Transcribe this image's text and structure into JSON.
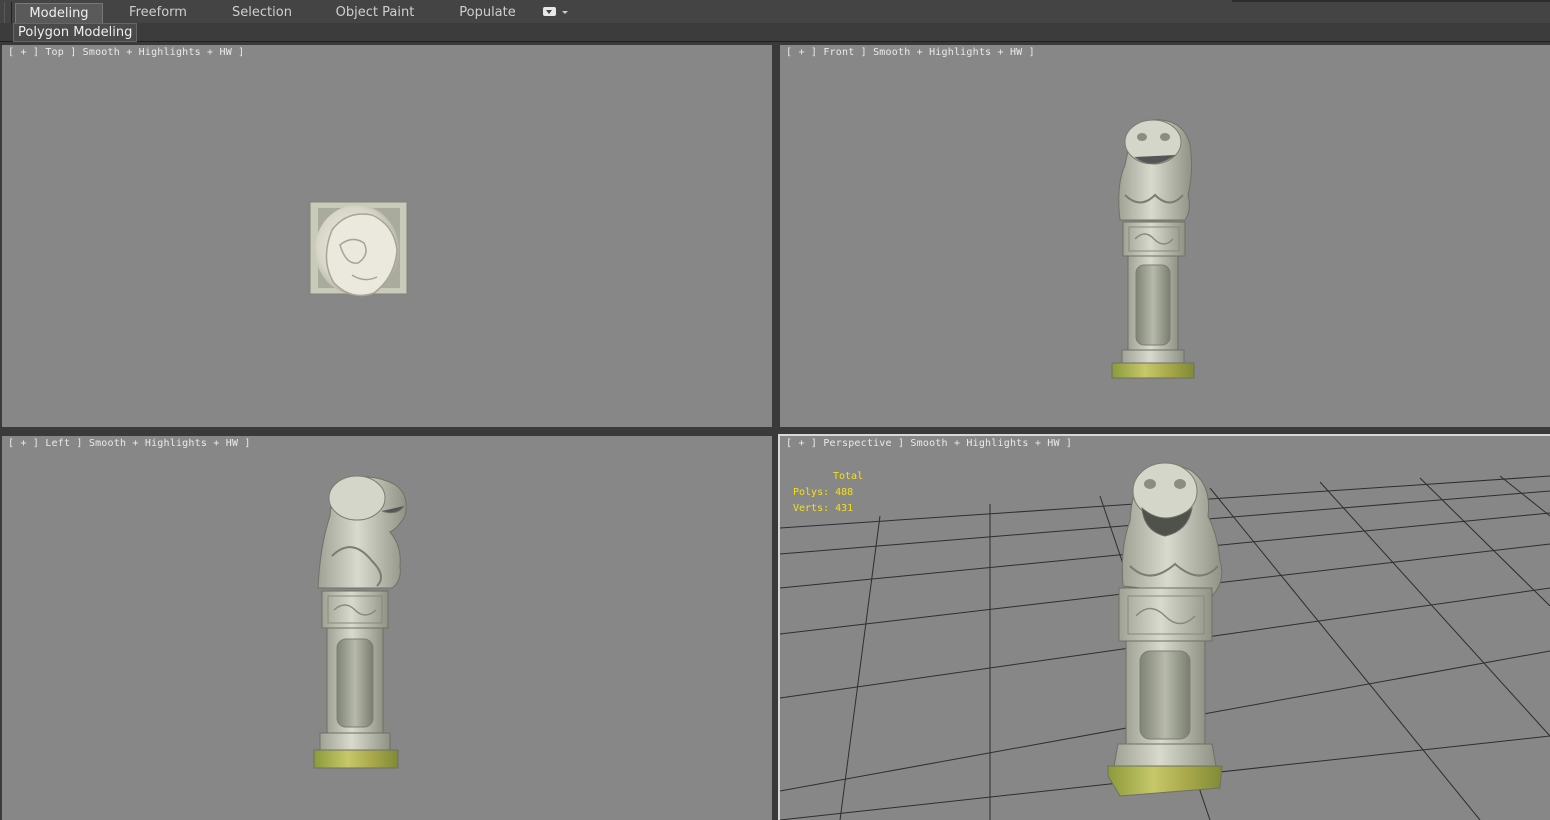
{
  "ribbon": {
    "tabs": [
      {
        "label": "Modeling",
        "active": true
      },
      {
        "label": "Freeform",
        "active": false
      },
      {
        "label": "Selection",
        "active": false
      },
      {
        "label": "Object Paint",
        "active": false
      },
      {
        "label": "Populate",
        "active": false
      }
    ],
    "panel_label": "Polygon Modeling"
  },
  "viewports": {
    "top": {
      "label": "[ + ] Top ] Smooth + Highlights + HW ]"
    },
    "front": {
      "label": "[ + ] Front ] Smooth + Highlights + HW ]"
    },
    "left": {
      "label": "[ + ] Left ] Smooth + Highlights + HW ]"
    },
    "perspective": {
      "label": "[ + ] Perspective ] Smooth + Highlights + HW ]",
      "stats": {
        "title": "Total",
        "polys": "Polys: 488",
        "verts": "Verts: 431"
      }
    }
  },
  "colors": {
    "viewport_bg": "#878787",
    "stats_text": "#f3e01b",
    "grid_line": "#2a2a2a",
    "stone": "#cfd0c2",
    "moss": "#9fa83c"
  }
}
